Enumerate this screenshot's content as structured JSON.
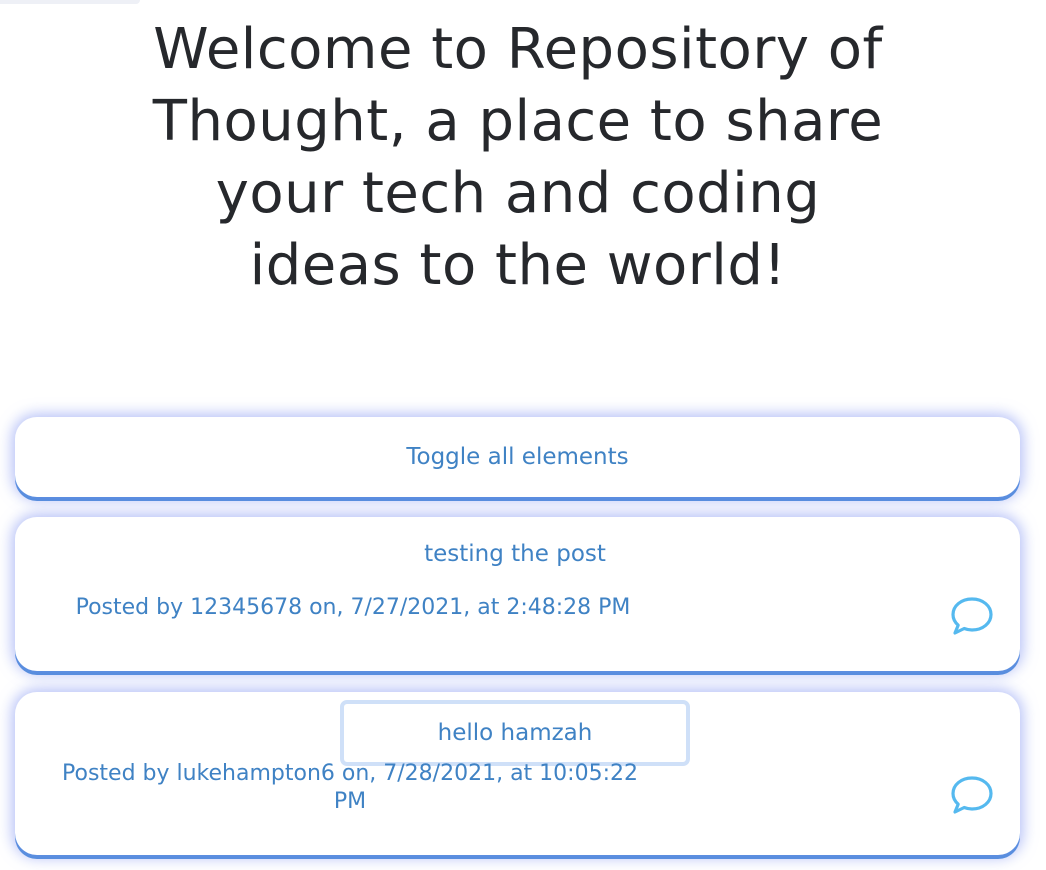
{
  "hero": {
    "title": "Welcome to Repository of Thought, a place to share your tech and coding ideas to the world!"
  },
  "toggle": {
    "label": "Toggle all elements"
  },
  "posts": [
    {
      "title": "testing the post",
      "meta": "Posted by 12345678 on, 7/27/2021, at 2:48:28 PM",
      "icon": "comment-icon"
    },
    {
      "title": "hello hamzah",
      "meta": "Posted by lukehampton6 on, 7/28/2021, at 10:05:22 PM",
      "icon": "comment-icon"
    }
  ],
  "colors": {
    "accent": "#3f82c4",
    "icon": "#55b9ef",
    "glow": "#7a8cf0"
  }
}
